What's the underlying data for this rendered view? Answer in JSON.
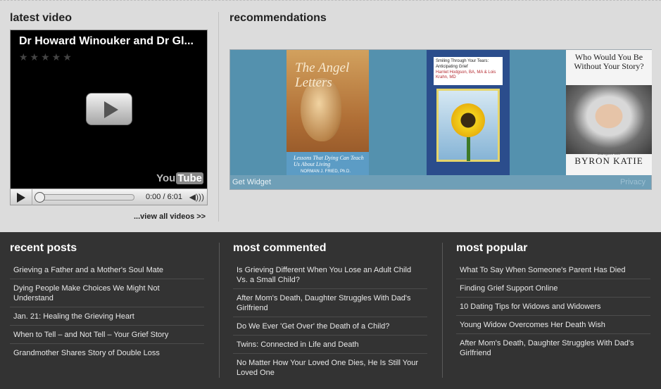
{
  "latest_video": {
    "heading": "latest video",
    "title": "Dr Howard Winouker and Dr Gl...",
    "stars": "★★★★★",
    "logo_you": "You",
    "logo_tube": "Tube",
    "time": "0:00 / 6:01",
    "view_all": "...view all videos >>"
  },
  "recommendations": {
    "heading": "recommendations",
    "books": [
      {
        "title": "The Angel Letters",
        "subtitle": "Lessons That Dying Can Teach Us About Living",
        "author": "NORMAN J. FRIED, Ph.D."
      },
      {
        "title_line1": "Smiling Through Your Tears:",
        "title_line2": "Anticipating Grief",
        "authors": "Harriet Hodgson, BA, MA & Lois Krahn, MD"
      },
      {
        "title": "Who Would You Be Without Your Story?",
        "with": "Dialogues with",
        "author": "BYRON KATIE"
      }
    ],
    "get_widget": "Get Widget",
    "privacy": "Privacy"
  },
  "recent_posts": {
    "heading": "recent posts",
    "items": [
      "Grieving a Father and a Mother's Soul Mate",
      "Dying People Make Choices We Might Not Understand",
      "Jan. 21: Healing the Grieving Heart",
      "When to Tell – and Not Tell – Your Grief Story",
      "Grandmother Shares Story of Double Loss"
    ]
  },
  "most_commented": {
    "heading": "most commented",
    "items": [
      "Is Grieving Different When You Lose an Adult Child Vs. a Small Child?",
      "After Mom's Death, Daughter Struggles With Dad's Girlfriend",
      "Do We Ever 'Get Over' the Death of a Child?",
      "Twins: Connected in Life and Death",
      "No Matter How Your Loved One Dies, He Is Still Your Loved One"
    ]
  },
  "most_popular": {
    "heading": "most popular",
    "items": [
      "What To Say When Someone's Parent Has Died",
      "Finding Grief Support Online",
      "10 Dating Tips for Widows and Widowers",
      "Young Widow Overcomes Her Death Wish",
      "After Mom's Death, Daughter Struggles With Dad's Girlfriend"
    ]
  }
}
